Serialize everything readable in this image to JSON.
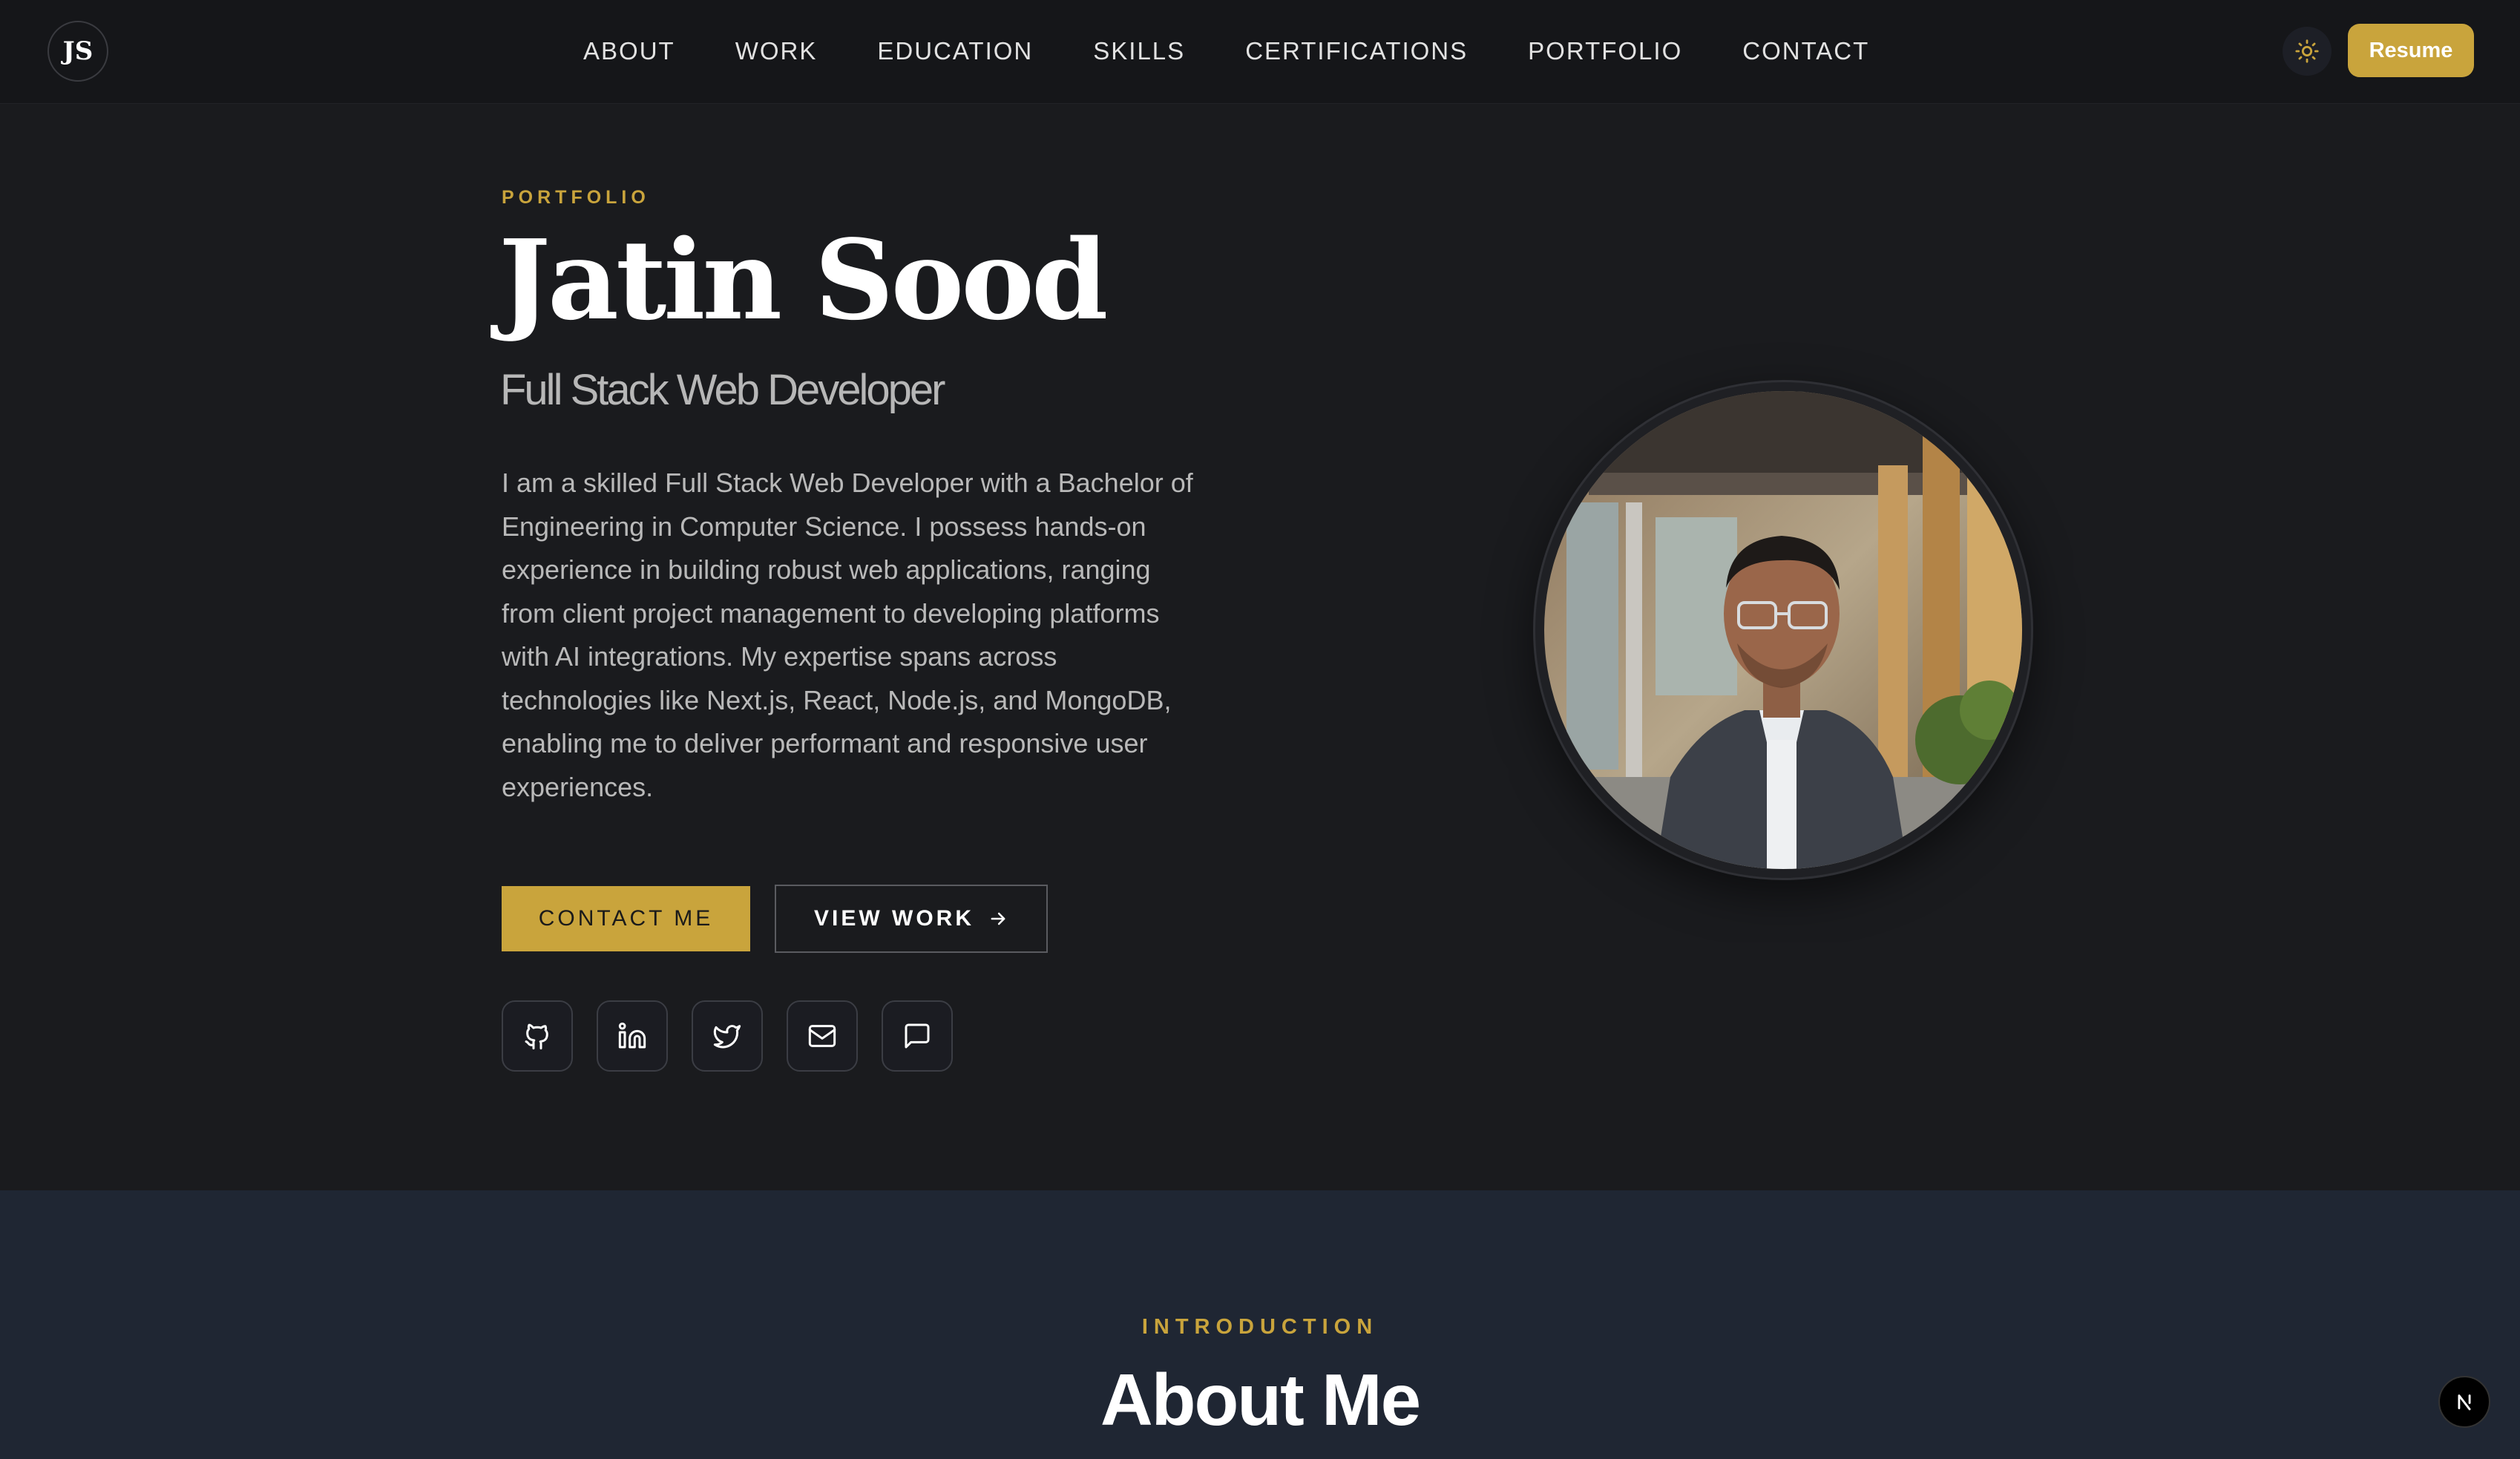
{
  "header": {
    "logo": "JS",
    "nav": [
      "ABOUT",
      "WORK",
      "EDUCATION",
      "SKILLS",
      "CERTIFICATIONS",
      "PORTFOLIO",
      "CONTACT"
    ],
    "theme_icon": "sun-icon",
    "resume_label": "Resume"
  },
  "hero": {
    "eyebrow": "PORTFOLIO",
    "name": "Jatin Sood",
    "role": "Full Stack Web Developer",
    "bio": "I am a skilled Full Stack Web Developer with a Bachelor of Engineering in Computer Science. I possess hands-on experience in building robust web applications, ranging from client project management to developing platforms with AI integrations. My expertise spans across technologies like Next.js, React, Node.js, and MongoDB, enabling me to deliver performant and responsive user experiences.",
    "contact_label": "CONTACT ME",
    "work_label": "VIEW WORK",
    "socials": [
      "github-icon",
      "linkedin-icon",
      "twitter-icon",
      "mail-icon",
      "chat-icon"
    ]
  },
  "about": {
    "eyebrow": "INTRODUCTION",
    "title": "About Me"
  },
  "colors": {
    "accent": "#c9a43c",
    "background": "#1a1b1e",
    "section_alt": "#1f2633"
  }
}
